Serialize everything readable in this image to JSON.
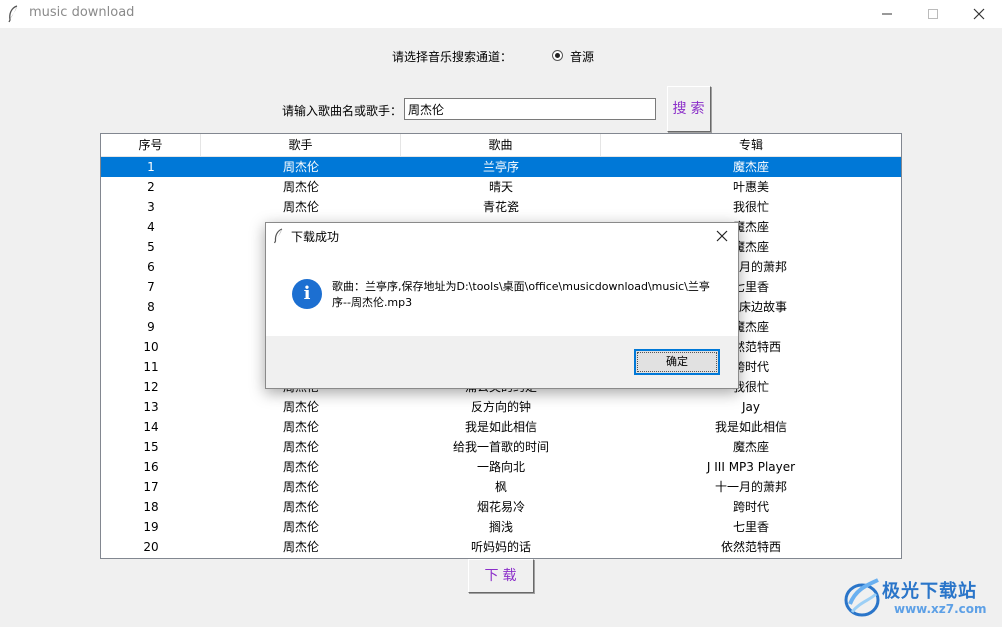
{
  "window": {
    "title": "music download"
  },
  "channel": {
    "label": "请选择音乐搜索通道：",
    "option_label": "音源"
  },
  "search": {
    "label": "请输入歌曲名或歌手：",
    "value": "周杰伦",
    "button_label": "搜索"
  },
  "table": {
    "headers": [
      "序号",
      "歌手",
      "歌曲",
      "专辑"
    ],
    "rows": [
      [
        "1",
        "周杰伦",
        "兰亭序",
        "魔杰座"
      ],
      [
        "2",
        "周杰伦",
        "晴天",
        "叶惠美"
      ],
      [
        "3",
        "周杰伦",
        "青花瓷",
        "我很忙"
      ],
      [
        "4",
        "",
        "",
        "魔杰座"
      ],
      [
        "5",
        "",
        "",
        "魔杰座"
      ],
      [
        "6",
        "",
        "",
        "十一月的萧邦"
      ],
      [
        "7",
        "",
        "",
        "七里香"
      ],
      [
        "8",
        "",
        "",
        "我的床边故事"
      ],
      [
        "9",
        "",
        "",
        "魔杰座"
      ],
      [
        "10",
        "",
        "",
        "依然范特西"
      ],
      [
        "11",
        "",
        "",
        "跨时代"
      ],
      [
        "12",
        "周杰伦",
        "蒲公英的约定",
        "我很忙"
      ],
      [
        "13",
        "周杰伦",
        "反方向的钟",
        "Jay"
      ],
      [
        "14",
        "周杰伦",
        "我是如此相信",
        "我是如此相信"
      ],
      [
        "15",
        "周杰伦",
        "给我一首歌的时间",
        "魔杰座"
      ],
      [
        "16",
        "周杰伦",
        "一路向北",
        "J III MP3 Player"
      ],
      [
        "17",
        "周杰伦",
        "枫",
        "十一月的萧邦"
      ],
      [
        "18",
        "周杰伦",
        "烟花易冷",
        "跨时代"
      ],
      [
        "19",
        "周杰伦",
        "搁浅",
        "七里香"
      ],
      [
        "20",
        "周杰伦",
        "听妈妈的话",
        "依然范特西"
      ]
    ],
    "selected_row": 0
  },
  "download": {
    "button_label": "下载"
  },
  "dialog": {
    "title": "下载成功",
    "message": "歌曲：兰亭序,保存地址为D:\\tools\\桌面\\office\\musicdownload\\music\\兰亭序--周杰伦.mp3",
    "ok_label": "确定"
  },
  "watermark": {
    "brand": "极光下载站",
    "url": "www.xz7.com"
  },
  "colors": {
    "selection": "#0078d7",
    "button_text": "#8b2fc9",
    "info_icon": "#1c6fd1"
  }
}
